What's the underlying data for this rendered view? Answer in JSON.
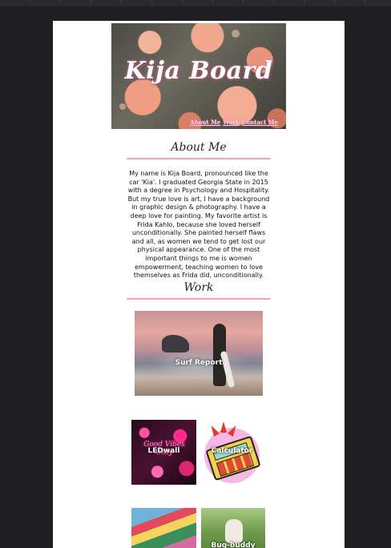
{
  "hero": {
    "title": "Kija Board",
    "nav": [
      "About Me",
      "Work",
      "Contact Me"
    ]
  },
  "about": {
    "heading": "About Me",
    "body": "My name is Kija Board, pronounced like the car 'Kia'. I graduated Georgia State in 2015 with a degree in Psychology and Hospitality. But my true love is art, I have a background in graphic design & photography. I have a deep love for painting. My favorite artist is Frida Kahlo, because she loved herself unconditionally. She painted herself flaws and all, as women we tend to get lost our physical appearance. One of the most important things to me is women empowerment, teaching women to love themselves as Frida did, unconditionally."
  },
  "work": {
    "heading": "Work",
    "projects": [
      {
        "label": "Surf Report"
      },
      {
        "label": "LEDwall"
      },
      {
        "label": "Calculator"
      },
      {
        "label": ""
      },
      {
        "label": "Bug-buddy"
      }
    ],
    "led_sign_text": "Good Vibes Only"
  },
  "colors": {
    "accent_rule": "#f1a5c0",
    "nav_link": "#ffd2e6",
    "background": "#1f1f21"
  }
}
